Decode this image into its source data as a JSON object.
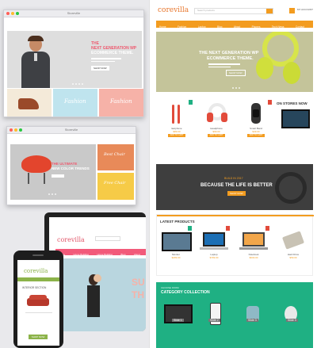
{
  "win1": {
    "title": "Storeville",
    "hero_line1": "THE",
    "hero_line2": "NEXT GENERATION WP",
    "hero_line3": "ECOMMERCE THEME.",
    "hero_btn": "SHOP NOW",
    "tile_text": "Fashion",
    "tile_text2": "Fashion"
  },
  "win2": {
    "title": "Storeville",
    "hero_line1": "THE ULTIMATE",
    "hero_line2": "NEW COLOR TRENDS",
    "tile1": "Best Chair",
    "tile2": "Free Chair"
  },
  "laptop": {
    "logo": "corevilla",
    "nav": [
      "Home",
      "Home Building",
      "Home Building",
      "Blog",
      "About"
    ],
    "hero_text": "SU",
    "hero_text2": "TH"
  },
  "phone": {
    "logo": "corevilla",
    "section": "INTERIOR SECTION",
    "btn": "SHOP NOW"
  },
  "site": {
    "logo": "corevilla",
    "search_placeholder": "Search products",
    "account": "MY ACCOUNT",
    "nav": [
      "Home",
      "Fashion",
      "Laptop",
      "Blog",
      "About",
      "Phones",
      "Tech News",
      "Contact"
    ],
    "hero_line1": "THE NEXT GENERATION WP",
    "hero_line2": "ECOMMERCE THEME.",
    "hero_btn": "SHOP NOW",
    "section1": "ON STORES NOW",
    "row1": [
      {
        "name": "Earphone",
        "price": "$89.00",
        "btn": "ADD TO CART"
      },
      {
        "name": "Headphone",
        "price": "$99.00",
        "btn": "ADD TO CART"
      },
      {
        "name": "Smart Band",
        "price": "$49.00",
        "btn": "ADD TO CART"
      }
    ],
    "banner_small": "BUILD IN 2017",
    "banner_text": "BECAUSE THE LIFE IS BETTER",
    "banner_btn": "SHOP NOW",
    "latest_title": "LATEST PRODUCTS",
    "row2": [
      {
        "name": "Monitor",
        "price": "$299.00",
        "btn": "ADD TO CART"
      },
      {
        "name": "Laptop",
        "price": "$799.00",
        "btn": "ADD TO CART"
      },
      {
        "name": "Notebook",
        "price": "$649.00",
        "btn": "ADD TO CART"
      },
      {
        "name": "Hard Drive",
        "price": "$59.00",
        "btn": "ADD TO CART"
      }
    ],
    "cat_small": "CHOOSE FROM",
    "cat_title": "CATEGORY COLLECTION",
    "slides": [
      "Slide 1",
      "Slide 2",
      "Slide 3",
      "Slide 3"
    ]
  },
  "colors": {
    "accent": "#f39c1f",
    "red": "#e24b3b",
    "green": "#1fb083",
    "olive": "#c4c49a",
    "pink": "#f25a7a"
  }
}
